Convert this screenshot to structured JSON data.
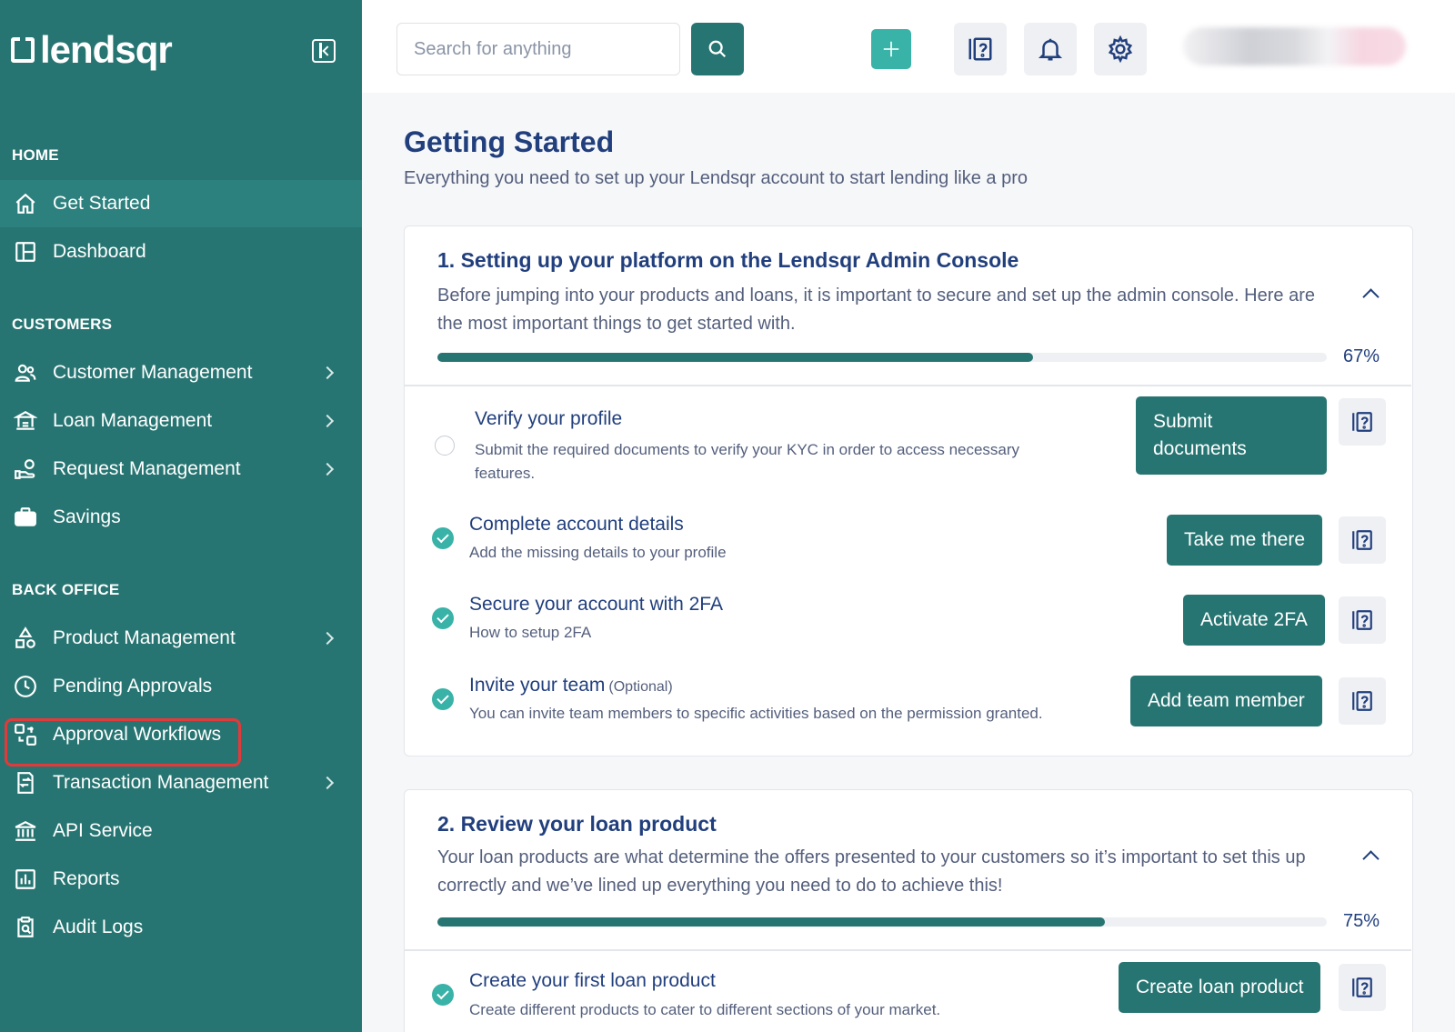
{
  "brand": {
    "name": "lendsqr",
    "accent": "#277572",
    "accent_light": "#39b2a7",
    "text_dark": "#213f7d",
    "highlight": "#e23a3a"
  },
  "sidebar": {
    "sections": {
      "home": "HOME",
      "customers": "CUSTOMERS",
      "back_office": "BACK OFFICE"
    },
    "items": [
      {
        "label": "Get Started",
        "icon": "home-icon",
        "active": true
      },
      {
        "label": "Dashboard",
        "icon": "dashboard-icon"
      },
      {
        "label": "Customer Management",
        "icon": "users-icon",
        "submenu": true
      },
      {
        "label": "Loan Management",
        "icon": "loan-icon",
        "submenu": true
      },
      {
        "label": "Request Management",
        "icon": "request-icon",
        "submenu": true
      },
      {
        "label": "Savings",
        "icon": "briefcase-icon"
      },
      {
        "label": "Product Management",
        "icon": "shapes-icon",
        "submenu": true
      },
      {
        "label": "Pending Approvals",
        "icon": "clock-icon"
      },
      {
        "label": "Approval Workflows",
        "icon": "workflow-icon",
        "highlighted": true
      },
      {
        "label": "Transaction Management",
        "icon": "transaction-icon",
        "submenu": true
      },
      {
        "label": "API Service",
        "icon": "bank-icon"
      },
      {
        "label": "Reports",
        "icon": "chart-icon"
      },
      {
        "label": "Audit Logs",
        "icon": "audit-icon"
      }
    ]
  },
  "topbar": {
    "search_placeholder": "Search for anything",
    "icons": [
      "search-icon",
      "plus-icon",
      "help-book-icon",
      "bell-icon",
      "gear-icon"
    ]
  },
  "main": {
    "title": "Getting Started",
    "subtitle": "Everything you need to set up your Lendsqr account to start lending like a pro",
    "cards": [
      {
        "title": "1. Setting up your platform on the Lendsqr Admin Console",
        "desc": "Before jumping into your products and loans, it is important to secure and set up the admin console. Here are the most important things to get started with.",
        "progress_pct": "67%",
        "progress_value": 0.67,
        "tasks": [
          {
            "title": "Verify your profile",
            "desc": "Submit the required documents to verify your KYC in order to access necessary features.",
            "button": "Submit documents",
            "done": false
          },
          {
            "title": "Complete account details",
            "desc": "Add the missing details to your profile",
            "button": "Take me there",
            "done": true
          },
          {
            "title": "Secure your account with 2FA",
            "desc": "How to setup 2FA",
            "button": "Activate 2FA",
            "done": true
          },
          {
            "title": "Invite your team",
            "optional": "(Optional)",
            "desc": "You can invite team members to specific activities based on the permission granted.",
            "button": "Add team member",
            "done": true
          }
        ]
      },
      {
        "title": "2. Review your loan product",
        "desc": "Your loan products are what determine the offers presented to your customers so it’s important to set this up correctly and we’ve lined up everything you need to do to achieve this!",
        "progress_pct": "75%",
        "progress_value": 0.75,
        "tasks": [
          {
            "title": "Create your first loan product",
            "desc": "Create different products to cater to different sections of your market.",
            "button": "Create loan product",
            "done": true
          }
        ]
      }
    ]
  }
}
